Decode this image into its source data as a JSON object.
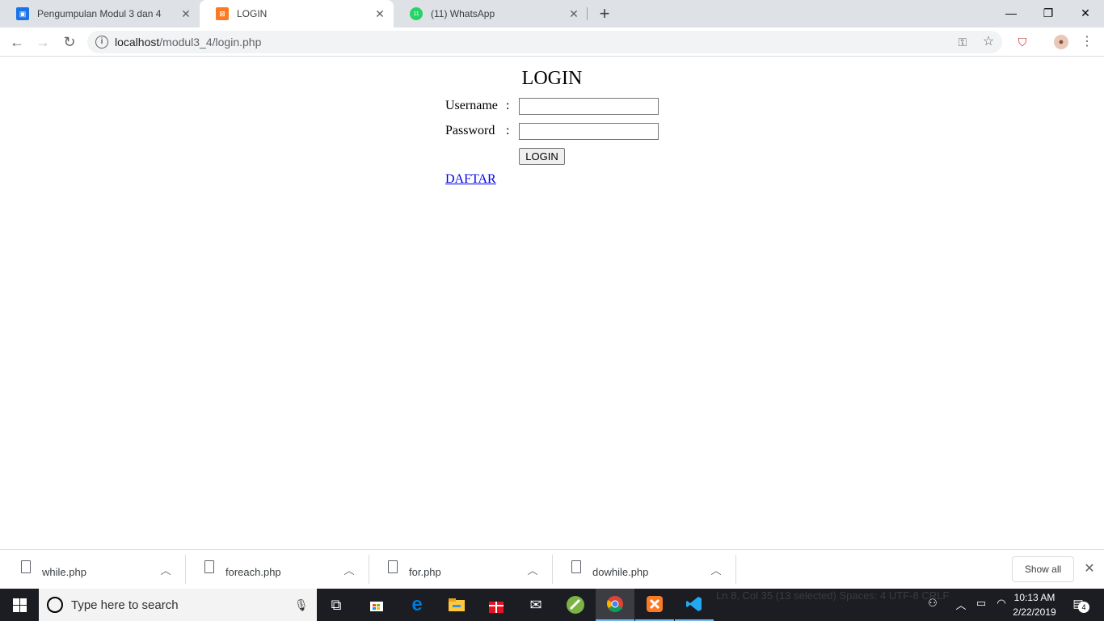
{
  "browser": {
    "tabs": [
      {
        "title": "Pengumpulan Modul 3 dan 4",
        "active": false,
        "favicon": "classroom-icon",
        "favicon_color": "#1a73e8"
      },
      {
        "title": "LOGIN",
        "active": true,
        "favicon": "xampp-icon",
        "favicon_color": "#fb7a24"
      },
      {
        "title": "(11) WhatsApp",
        "active": false,
        "favicon": "whatsapp-icon",
        "favicon_color": "#25d366",
        "badge": "11"
      }
    ],
    "new_tab_label": "+",
    "window_controls": {
      "minimize": "—",
      "restore": "❐",
      "close": "✕"
    },
    "address": {
      "host": "localhost",
      "path": "/modul3_4/login.php"
    }
  },
  "page": {
    "title": "LOGIN",
    "username_label": "Username",
    "password_label": "Password",
    "colon": ":",
    "username_value": "",
    "password_value": "",
    "login_button": "LOGIN",
    "register_link": "DAFTAR"
  },
  "downloads": {
    "items": [
      {
        "filename": "while.php"
      },
      {
        "filename": "foreach.php"
      },
      {
        "filename": "for.php"
      },
      {
        "filename": "dowhile.php"
      }
    ],
    "show_all_label": "Show all"
  },
  "taskbar": {
    "search_placeholder": "Type here to search",
    "status_ghost": "Ln 8, Col 35 (13 selected)    Spaces: 4    UTF-8    CRLF",
    "clock_time": "10:13 AM",
    "clock_date": "2/22/2019",
    "notification_count": "4"
  },
  "colors": {
    "link": "#0000ee",
    "tab_strip": "#dee1e6",
    "taskbar": "#1b1d23",
    "accent": "#76b9ed"
  }
}
